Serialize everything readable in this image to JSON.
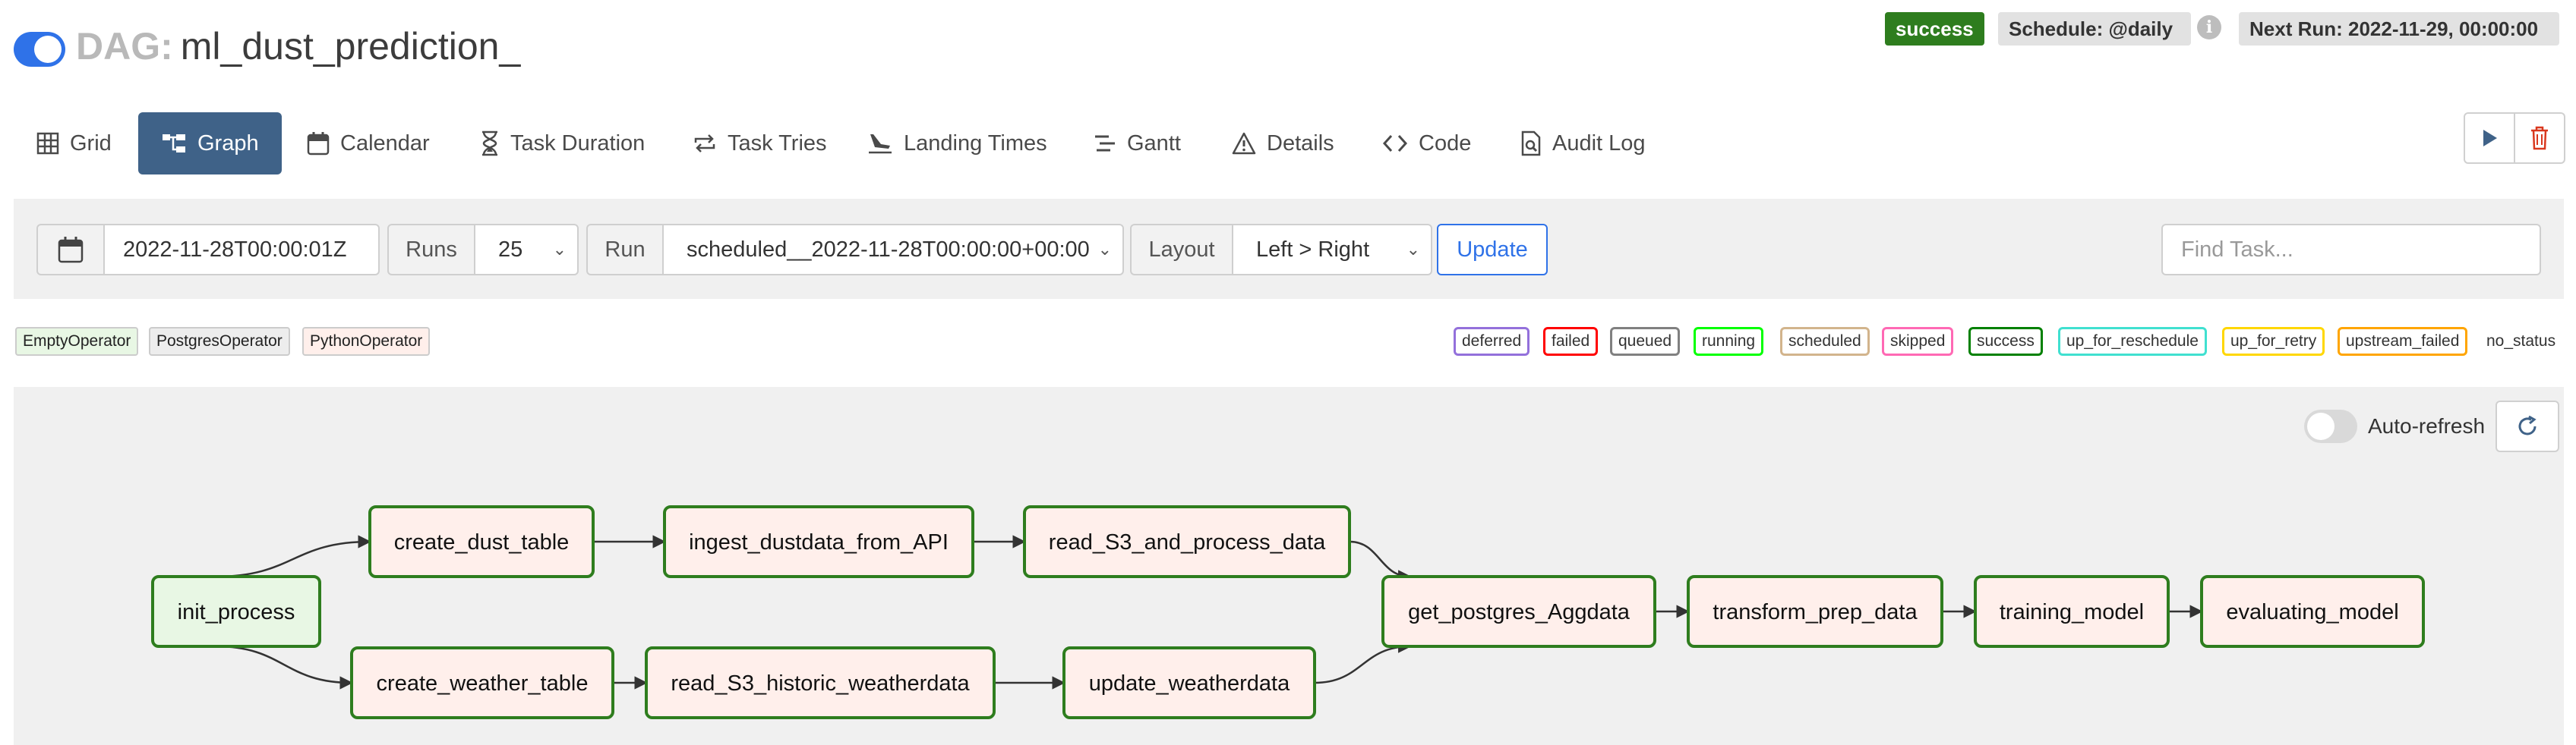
{
  "header": {
    "dag_prefix": "DAG:",
    "dag_id": "ml_dust_prediction_",
    "run_state": "success",
    "schedule": "Schedule: @daily",
    "info_icon": "i",
    "next_run": "Next Run: 2022-11-29, 00:00:00"
  },
  "nav": {
    "tabs": [
      {
        "label": "Grid",
        "icon": "grid-icon"
      },
      {
        "label": "Graph",
        "icon": "graph-icon"
      },
      {
        "label": "Calendar",
        "icon": "calendar-icon"
      },
      {
        "label": "Task Duration",
        "icon": "hourglass-icon"
      },
      {
        "label": "Task Tries",
        "icon": "retry-icon"
      },
      {
        "label": "Landing Times",
        "icon": "landing-icon"
      },
      {
        "label": "Gantt",
        "icon": "gantt-icon"
      },
      {
        "label": "Details",
        "icon": "warning-icon"
      },
      {
        "label": "Code",
        "icon": "code-icon"
      },
      {
        "label": "Audit Log",
        "icon": "audit-icon"
      }
    ],
    "active_tab": "Graph"
  },
  "toolbar": {
    "base_date": "2022-11-28T00:00:01Z",
    "runs_label": "Runs",
    "runs_value": "25",
    "run_label": "Run",
    "run_value": "scheduled__2022-11-28T00:00:00+00:00",
    "layout_label": "Layout",
    "layout_value": "Left > Right",
    "update_label": "Update",
    "find_placeholder": "Find Task..."
  },
  "legend": {
    "operators": [
      {
        "label": "EmptyOperator",
        "color": "#e8f7e4"
      },
      {
        "label": "PostgresOperator",
        "color": "#ededed"
      },
      {
        "label": "PythonOperator",
        "color": "#ffefeb"
      }
    ],
    "states": [
      {
        "label": "deferred",
        "color": "#9370db"
      },
      {
        "label": "failed",
        "color": "#ff0000"
      },
      {
        "label": "queued",
        "color": "#808080"
      },
      {
        "label": "running",
        "color": "#00ff00"
      },
      {
        "label": "scheduled",
        "color": "#d2b48c"
      },
      {
        "label": "skipped",
        "color": "#ff69b4"
      },
      {
        "label": "success",
        "color": "#008000"
      },
      {
        "label": "up_for_reschedule",
        "color": "#40e0d0"
      },
      {
        "label": "up_for_retry",
        "color": "#ffd700"
      },
      {
        "label": "upstream_failed",
        "color": "#ffa500"
      }
    ],
    "no_status": "no_status"
  },
  "graph": {
    "auto_refresh_label": "Auto-refresh",
    "auto_refresh_on": false,
    "node_border_color": "#2e7d1e",
    "nodes": [
      {
        "id": "init_process",
        "operator": "EmptyOperator",
        "state": "success"
      },
      {
        "id": "create_dust_table",
        "operator": "PythonOperator",
        "state": "success"
      },
      {
        "id": "ingest_dustdata_from_API",
        "operator": "PythonOperator",
        "state": "success"
      },
      {
        "id": "read_S3_and_process_data",
        "operator": "PythonOperator",
        "state": "success"
      },
      {
        "id": "create_weather_table",
        "operator": "PythonOperator",
        "state": "success"
      },
      {
        "id": "read_S3_historic_weatherdata",
        "operator": "PythonOperator",
        "state": "success"
      },
      {
        "id": "update_weatherdata",
        "operator": "PythonOperator",
        "state": "success"
      },
      {
        "id": "get_postgres_Aggdata",
        "operator": "PythonOperator",
        "state": "success"
      },
      {
        "id": "transform_prep_data",
        "operator": "PythonOperator",
        "state": "success"
      },
      {
        "id": "training_model",
        "operator": "PythonOperator",
        "state": "success"
      },
      {
        "id": "evaluating_model",
        "operator": "PythonOperator",
        "state": "success"
      }
    ],
    "edges": [
      [
        "init_process",
        "create_dust_table"
      ],
      [
        "init_process",
        "create_weather_table"
      ],
      [
        "create_dust_table",
        "ingest_dustdata_from_API"
      ],
      [
        "ingest_dustdata_from_API",
        "read_S3_and_process_data"
      ],
      [
        "read_S3_and_process_data",
        "get_postgres_Aggdata"
      ],
      [
        "create_weather_table",
        "read_S3_historic_weatherdata"
      ],
      [
        "read_S3_historic_weatherdata",
        "update_weatherdata"
      ],
      [
        "update_weatherdata",
        "get_postgres_Aggdata"
      ],
      [
        "get_postgres_Aggdata",
        "transform_prep_data"
      ],
      [
        "transform_prep_data",
        "training_model"
      ],
      [
        "training_model",
        "evaluating_model"
      ]
    ]
  }
}
